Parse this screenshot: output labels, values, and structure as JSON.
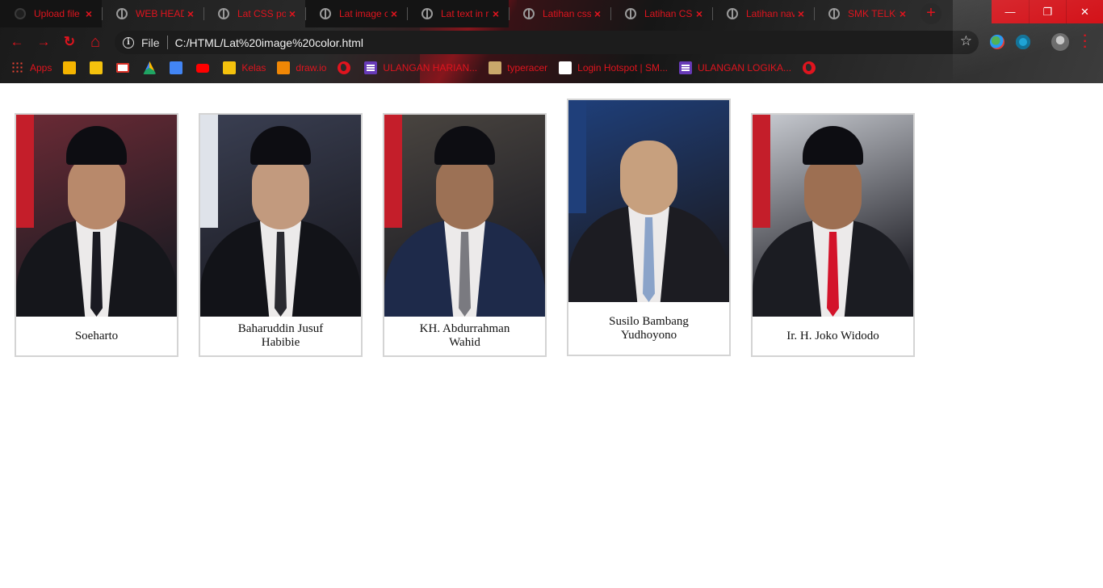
{
  "tabs": [
    {
      "label": "Upload file",
      "icon": "github-icon",
      "active": true
    },
    {
      "label": "WEB HEAD",
      "icon": "globe-icon"
    },
    {
      "label": "Lat CSS pos",
      "icon": "globe-icon"
    },
    {
      "label": "Lat image c",
      "icon": "globe-icon",
      "active": true
    },
    {
      "label": "Lat text in r",
      "icon": "globe-icon",
      "active": true
    },
    {
      "label": "Latihan css",
      "icon": "globe-icon"
    },
    {
      "label": "Latihan CSS",
      "icon": "globe-icon"
    },
    {
      "label": "Latihan nav",
      "icon": "globe-icon"
    },
    {
      "label": "SMK TELKO",
      "icon": "globe-icon"
    }
  ],
  "tab_close_glyph": "×",
  "new_tab_glyph": "+",
  "window_controls": {
    "minimize": "—",
    "restore": "❐",
    "close": "✕"
  },
  "toolbar": {
    "back_glyph": "←",
    "forward_glyph": "→",
    "reload_glyph": "↻",
    "home_glyph": "⌂",
    "info_glyph": "i",
    "scheme_label": "File",
    "url": "C:/HTML/Lat%20image%20color.html",
    "star_glyph": "☆"
  },
  "bookmarks": [
    {
      "label": "Apps",
      "icon": "apps-grid-icon",
      "color": "#ea4335"
    },
    {
      "label": "",
      "icon": "google-slides-icon",
      "color": "#f4b400"
    },
    {
      "label": "",
      "icon": "google-classroom-icon",
      "color": "#f4c20d"
    },
    {
      "label": "",
      "icon": "gmail-icon",
      "color": "#ffffff"
    },
    {
      "label": "",
      "icon": "google-drive-icon",
      "color": "#1fa463"
    },
    {
      "label": "",
      "icon": "google-docs-icon",
      "color": "#4285f4"
    },
    {
      "label": "",
      "icon": "youtube-icon",
      "color": "#ff0000"
    },
    {
      "label": "Kelas",
      "icon": "google-classroom-icon",
      "color": "#f4c20d"
    },
    {
      "label": "draw.io",
      "icon": "drawio-icon",
      "color": "#f08705"
    },
    {
      "label": "",
      "icon": "globe-icon",
      "color": "#e0141e"
    },
    {
      "label": "ULANGAN HARIAN...",
      "icon": "google-forms-icon",
      "color": "#673ab7"
    },
    {
      "label": "typeracer",
      "icon": "typeracer-icon",
      "color": "#c9a86b"
    },
    {
      "label": "Login Hotspot | SM...",
      "icon": "hotspot-icon",
      "color": "#ffffff"
    },
    {
      "label": "ULANGAN LOGIKA...",
      "icon": "google-forms-icon",
      "color": "#673ab7"
    },
    {
      "label": "",
      "icon": "globe-icon",
      "color": "#e0141e"
    }
  ],
  "gallery": [
    {
      "caption": "Soeharto",
      "bg": "#6b2a35",
      "suit": "#15161b",
      "skin": "#b8896b",
      "tie": "#1a1a22",
      "flag": "#c41e2a",
      "raised": false
    },
    {
      "caption": "Baharuddin Jusuf Habibie",
      "bg": "#3a3f52",
      "suit": "#121318",
      "skin": "#c29a7e",
      "tie": "#2a2a30",
      "flag": "#dfe3ea",
      "raised": false
    },
    {
      "caption": "KH. Abdurrahman Wahid",
      "bg": "#4a4540",
      "suit": "#1e2a4a",
      "skin": "#9c7155",
      "tie": "#7a7a80",
      "flag": "#c41e2a",
      "raised": false
    },
    {
      "caption": "Susilo Bambang Yudhoyono",
      "bg": "#1f3f7a",
      "suit": "#1c1c22",
      "skin": "#c7a07e",
      "tie": "#8aa3c9",
      "flag": "#1f3f7a",
      "raised": true
    },
    {
      "caption": "Ir. H. Joko Widodo",
      "bg": "#c9ccd2",
      "suit": "#1b1c22",
      "skin": "#9d6f52",
      "tie": "#d3132a",
      "flag": "#c41e2a",
      "raised": false
    }
  ]
}
